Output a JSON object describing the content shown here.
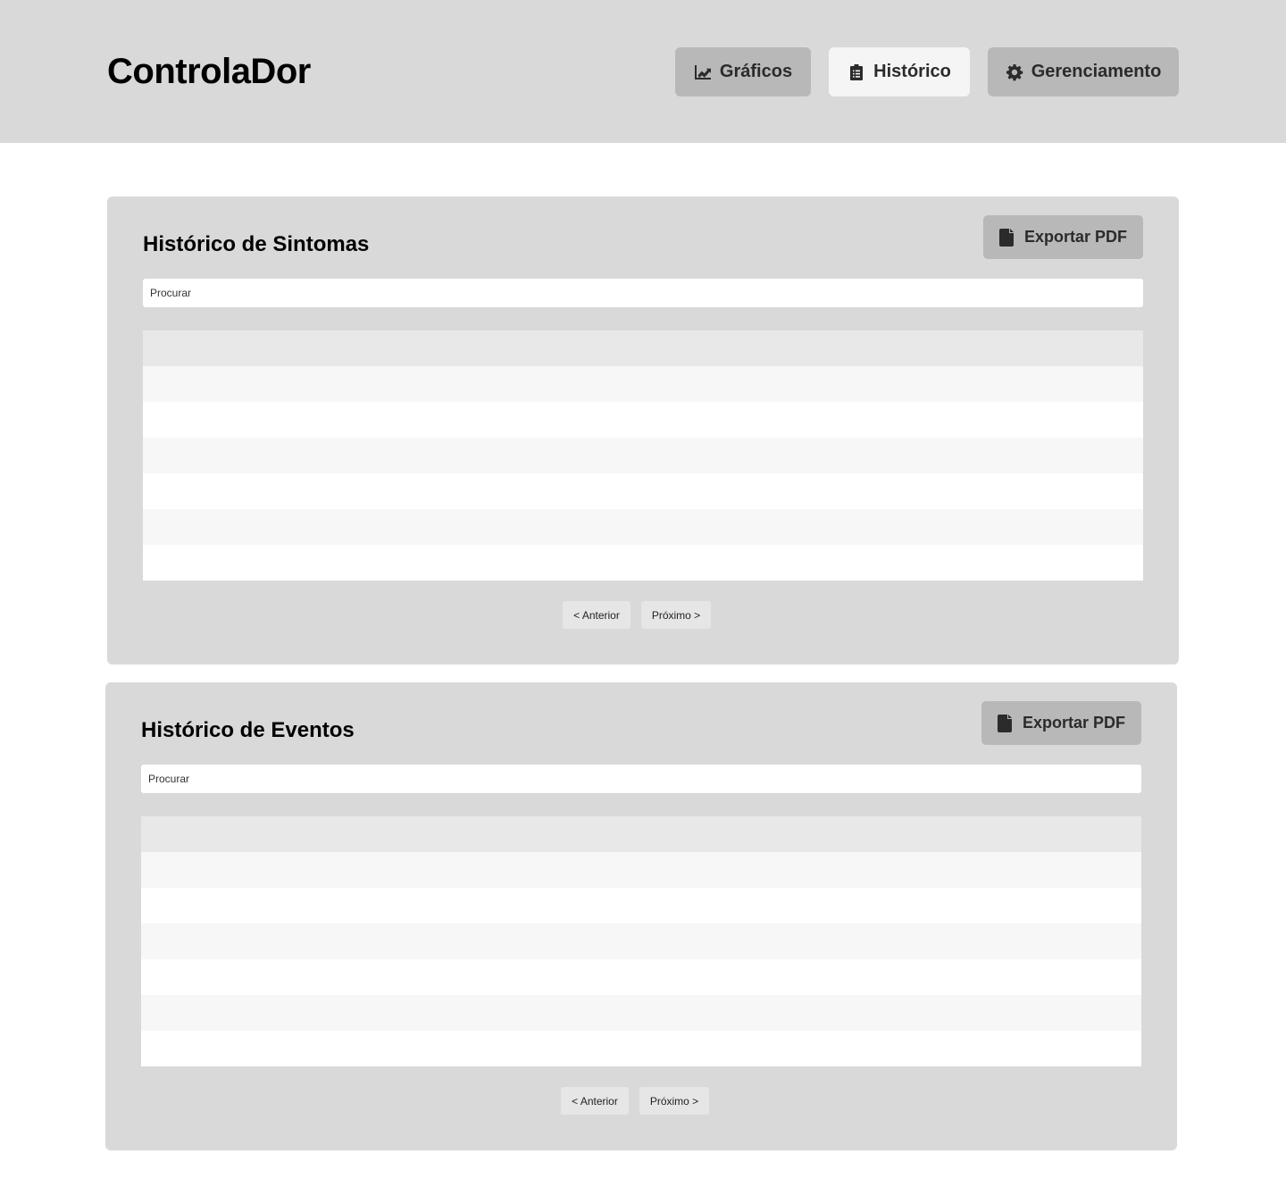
{
  "app": {
    "title": "ControlaDor"
  },
  "nav": [
    {
      "label": "Gráficos",
      "icon": "chart-line-icon",
      "active": false
    },
    {
      "label": "Histórico",
      "icon": "clipboard-list-icon",
      "active": true
    },
    {
      "label": "Gerenciamento",
      "icon": "gear-icon",
      "active": false
    }
  ],
  "sections": [
    {
      "title": "Histórico de Sintomas",
      "export_label": "Exportar PDF",
      "export_icon": "file-icon",
      "search_placeholder": "Procurar",
      "table_rows": 7,
      "prev_label": "< Anterior",
      "next_label": "Próximo >"
    },
    {
      "title": "Histórico de Eventos",
      "export_label": "Exportar PDF",
      "export_icon": "file-icon",
      "search_placeholder": "Procurar",
      "table_rows": 7,
      "prev_label": "< Anterior",
      "next_label": "Próximo >"
    }
  ],
  "colors": {
    "header_bg": "#d9d9d9",
    "panel_bg": "#d9d9d9",
    "button_bg": "#b8b8b8",
    "active_button_bg": "#f5f5f5",
    "table_header_bg": "#e8e8e8",
    "table_alt_row_bg": "#f7f7f7"
  }
}
